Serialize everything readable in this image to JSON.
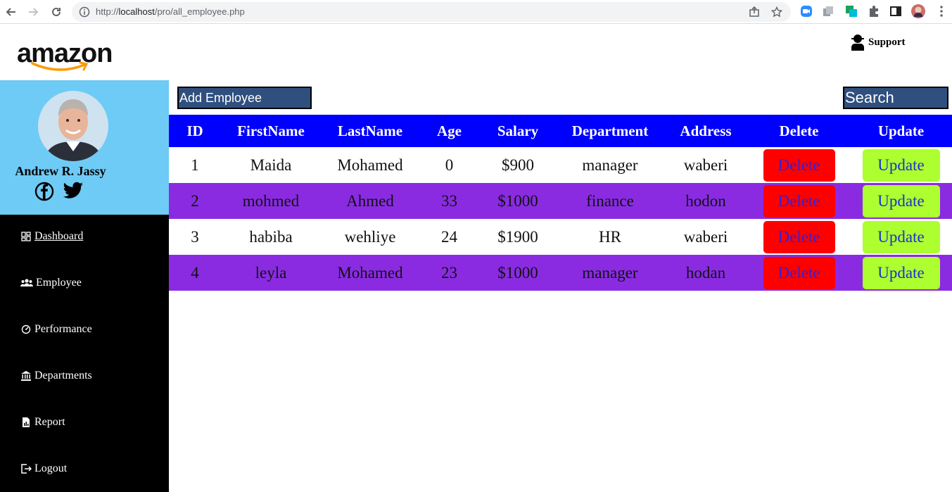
{
  "browser": {
    "url_prefix": "http://",
    "url_host": "localhost",
    "url_path": "/pro/all_employee.php"
  },
  "brand": {
    "logo_text": "amazon"
  },
  "header": {
    "support_label": "Support"
  },
  "profile": {
    "name": "Andrew R. Jassy"
  },
  "sidebar": {
    "items": [
      {
        "label": "Dashboard",
        "icon": "dashboard-icon"
      },
      {
        "label": "Employee",
        "icon": "people-icon"
      },
      {
        "label": "Performance",
        "icon": "gauge-icon"
      },
      {
        "label": "Departments",
        "icon": "bank-icon"
      },
      {
        "label": "Report",
        "icon": "report-icon"
      },
      {
        "label": "Logout",
        "icon": "logout-icon"
      }
    ]
  },
  "toolbar": {
    "add_label": "Add Employee",
    "search_placeholder": "Search"
  },
  "table": {
    "headers": [
      "ID",
      "FirstName",
      "LastName",
      "Age",
      "Salary",
      "Department",
      "Address",
      "Delete",
      "Update"
    ],
    "rows": [
      {
        "id": "1",
        "first": "Maida",
        "last": "Mohamed",
        "age": "0",
        "salary": "$900",
        "department": "manager",
        "address": "waberi",
        "delete": "Delete",
        "update": "Update"
      },
      {
        "id": "2",
        "first": "mohmed",
        "last": "Ahmed",
        "age": "33",
        "salary": "$1000",
        "department": "finance",
        "address": "hodon",
        "delete": "Delete",
        "update": "Update"
      },
      {
        "id": "3",
        "first": "habiba",
        "last": "wehliye",
        "age": "24",
        "salary": "$1900",
        "department": "HR",
        "address": "waberi",
        "delete": "Delete",
        "update": "Update"
      },
      {
        "id": "4",
        "first": "leyla",
        "last": "Mohamed",
        "age": "23",
        "salary": "$1000",
        "department": "manager",
        "address": "hodan",
        "delete": "Delete",
        "update": "Update"
      }
    ]
  },
  "colors": {
    "header_row": "#0000ff",
    "alt_row": "#8a2be2",
    "delete_button": "#ff0000",
    "update_button": "#adff2f",
    "sidebar_profile": "#6ecbf5",
    "sidebar_menu": "#000000",
    "toolbar_button": "#2f4f7f"
  }
}
